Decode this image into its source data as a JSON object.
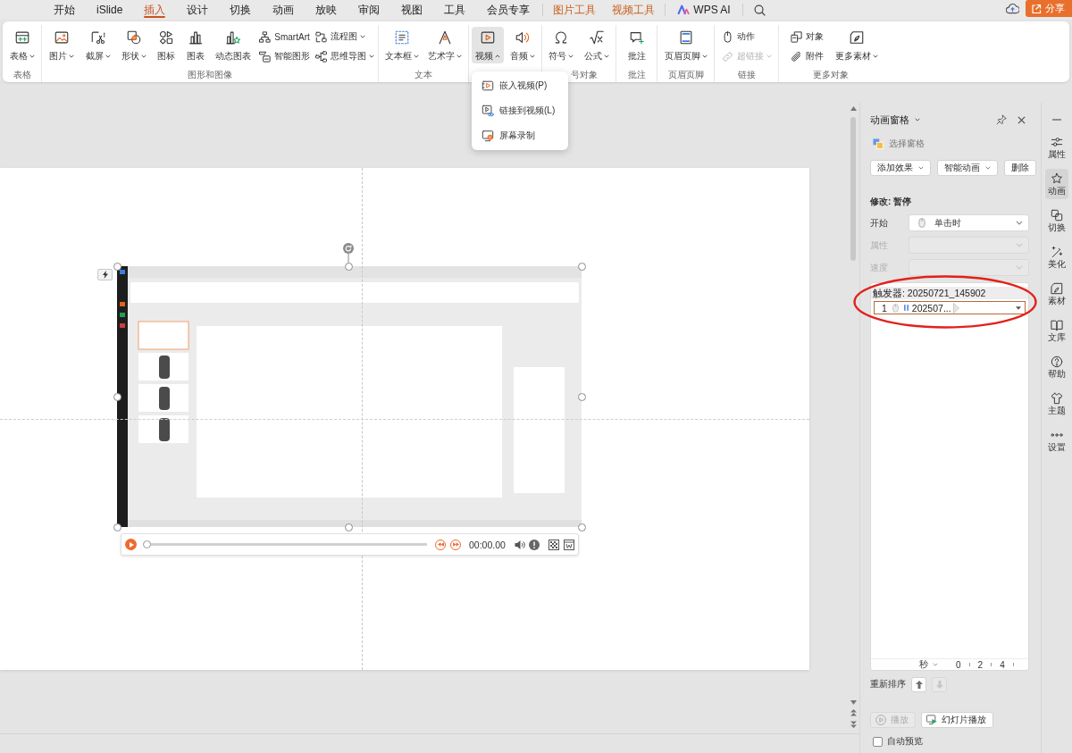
{
  "top_tabs": [
    {
      "label": "开始",
      "selected": false
    },
    {
      "label": "iSlide",
      "selected": false
    },
    {
      "label": "插入",
      "selected": true
    },
    {
      "label": "设计",
      "selected": false
    },
    {
      "label": "切换",
      "selected": false
    },
    {
      "label": "动画",
      "selected": false
    },
    {
      "label": "放映",
      "selected": false
    },
    {
      "label": "审阅",
      "selected": false
    },
    {
      "label": "视图",
      "selected": false
    },
    {
      "label": "工具",
      "selected": false
    },
    {
      "label": "会员专享",
      "selected": false
    }
  ],
  "context_tabs": [
    {
      "label": "图片工具"
    },
    {
      "label": "视频工具"
    }
  ],
  "ai_tab": {
    "label": "WPS AI"
  },
  "share_button": {
    "label": "分享"
  },
  "ribbon": [
    {
      "label": "表格",
      "items": [
        {
          "kind": "large",
          "label": "表格",
          "dropdown": true,
          "disabled": false,
          "expanded": false
        }
      ]
    },
    {
      "label": "图形和图像",
      "items": [
        {
          "kind": "large",
          "label": "图片",
          "dropdown": true,
          "disabled": false,
          "expanded": false
        },
        {
          "kind": "large",
          "label": "截屏",
          "dropdown": true,
          "disabled": false,
          "expanded": false
        },
        {
          "kind": "large",
          "label": "形状",
          "dropdown": true,
          "disabled": false,
          "expanded": false
        },
        {
          "kind": "large",
          "label": "图标",
          "dropdown": false,
          "disabled": false,
          "expanded": false
        },
        {
          "kind": "large",
          "label": "图表",
          "dropdown": false,
          "disabled": false,
          "expanded": false
        },
        {
          "kind": "large",
          "label": "动态图表",
          "dropdown": false,
          "disabled": false,
          "expanded": false
        },
        {
          "kind": "stack",
          "rows": [
            {
              "label": "SmartArt",
              "dropdown": false,
              "disabled": false
            },
            {
              "label": "智能图形",
              "dropdown": false,
              "disabled": false
            }
          ]
        },
        {
          "kind": "stack",
          "rows": [
            {
              "label": "流程图",
              "dropdown": true,
              "disabled": false
            },
            {
              "label": "思维导图",
              "dropdown": true,
              "disabled": false
            }
          ]
        }
      ]
    },
    {
      "label": "文本",
      "items": [
        {
          "kind": "large",
          "label": "文本框",
          "dropdown": true,
          "disabled": false,
          "expanded": false
        },
        {
          "kind": "large",
          "label": "艺术字",
          "dropdown": true,
          "disabled": false,
          "expanded": false
        }
      ]
    },
    {
      "items": [
        {
          "kind": "large",
          "label": "视频",
          "dropdown": true,
          "disabled": false,
          "expanded": true,
          "menu": [
            {
              "label": "嵌入视频(P)"
            },
            {
              "label": "链接到视频(L)"
            },
            {
              "label": "屏幕录制"
            }
          ]
        },
        {
          "kind": "large",
          "label": "音频",
          "dropdown": true,
          "disabled": false,
          "expanded": false
        }
      ]
    },
    {
      "label": "号对象",
      "items": [
        {
          "kind": "large",
          "label": "符号",
          "dropdown": true,
          "disabled": false,
          "expanded": false
        },
        {
          "kind": "large",
          "label": "公式",
          "dropdown": true,
          "disabled": false,
          "expanded": false
        }
      ]
    },
    {
      "label": "批注",
      "items": [
        {
          "kind": "large",
          "label": "批注",
          "dropdown": false,
          "disabled": false,
          "expanded": false
        }
      ]
    },
    {
      "label": "页眉页脚",
      "items": [
        {
          "kind": "large",
          "label": "页眉页脚",
          "dropdown": true,
          "disabled": false,
          "expanded": false
        }
      ]
    },
    {
      "label": "链接",
      "items": [
        {
          "kind": "stack",
          "rows": [
            {
              "label": "动作",
              "dropdown": false,
              "disabled": false
            },
            {
              "label": "超链接",
              "dropdown": true,
              "disabled": true
            }
          ]
        }
      ]
    },
    {
      "label": "更多对象",
      "items": [
        {
          "kind": "stack",
          "rows": [
            {
              "label": "对象",
              "dropdown": false,
              "disabled": false
            },
            {
              "label": "附件",
              "dropdown": false,
              "disabled": false
            }
          ]
        },
        {
          "kind": "large",
          "label": "更多素材",
          "dropdown": true,
          "disabled": false,
          "expanded": false
        }
      ]
    }
  ],
  "video_player": {
    "time": "00:00.00",
    "level": 0
  },
  "animation_pane": {
    "title": "动画窗格",
    "select_pane": "选择窗格",
    "actions": [
      {
        "label": "添加效果",
        "dropdown": true
      },
      {
        "label": "智能动画",
        "dropdown": true
      },
      {
        "label": "删除",
        "dropdown": false
      }
    ],
    "modify": "修改: 暂停",
    "settings": [
      {
        "label": "开始",
        "value": "单击时",
        "disabled": false
      },
      {
        "label": "属性",
        "disabled": true
      },
      {
        "label": "速度",
        "disabled": true
      }
    ],
    "trigger": "触发器: 20250721_145902",
    "effects": [
      {
        "number": "1",
        "name": "202507...",
        "selected": true
      }
    ],
    "timeline": {
      "unit": "秒",
      "ticks": [
        "0",
        "2",
        "4"
      ]
    },
    "reorder": {
      "label": "重新排序",
      "buttons": [
        {
          "kind": "up",
          "disabled": false
        },
        {
          "kind": "down",
          "disabled": true
        }
      ]
    },
    "play": {
      "label": "播放",
      "disabled": true
    },
    "slideshow": {
      "label": "幻灯片播放",
      "disabled": false
    },
    "auto_preview": {
      "label": "自动预览",
      "checked": false
    }
  },
  "side_tabs": [
    {
      "label": "属性",
      "selected": false
    },
    {
      "label": "动画",
      "selected": true
    },
    {
      "label": "切换",
      "selected": false
    },
    {
      "label": "美化",
      "selected": false
    },
    {
      "label": "素材",
      "selected": false
    },
    {
      "label": "文库",
      "selected": false
    },
    {
      "label": "帮助",
      "selected": false
    },
    {
      "label": "主题",
      "selected": false
    },
    {
      "label": "设置",
      "selected": false
    }
  ]
}
